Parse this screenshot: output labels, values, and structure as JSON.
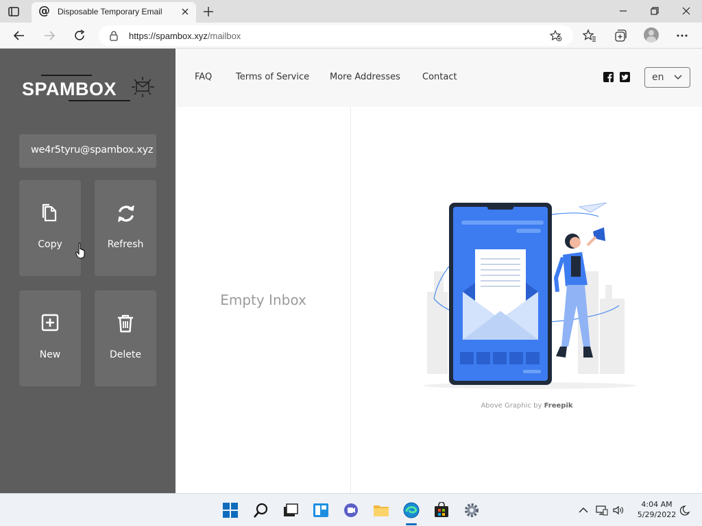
{
  "browser": {
    "tab_title": "Disposable Temporary Email",
    "tab_favicon": "@",
    "url_host": "https://spambox.xyz",
    "url_path": "/mailbox"
  },
  "site": {
    "logo_text": "SPAMBOX",
    "email_address": "we4r5tyru@spambox.xyz",
    "actions": {
      "copy": "Copy",
      "refresh": "Refresh",
      "new": "New",
      "delete": "Delete"
    },
    "nav": {
      "faq": "FAQ",
      "terms": "Terms of Service",
      "more_addresses": "More Addresses",
      "contact": "Contact"
    },
    "language": "en",
    "inbox_empty_text": "Empty Inbox",
    "credit_prefix": "Above Graphic by ",
    "credit_author": "Freepik"
  },
  "taskbar": {
    "time": "4:04 AM",
    "date": "5/29/2022"
  },
  "colors": {
    "sidebar_bg": "#5d5d5d",
    "tile_bg": "#6b6b6b",
    "accent_blue": "#3d7bf0"
  }
}
